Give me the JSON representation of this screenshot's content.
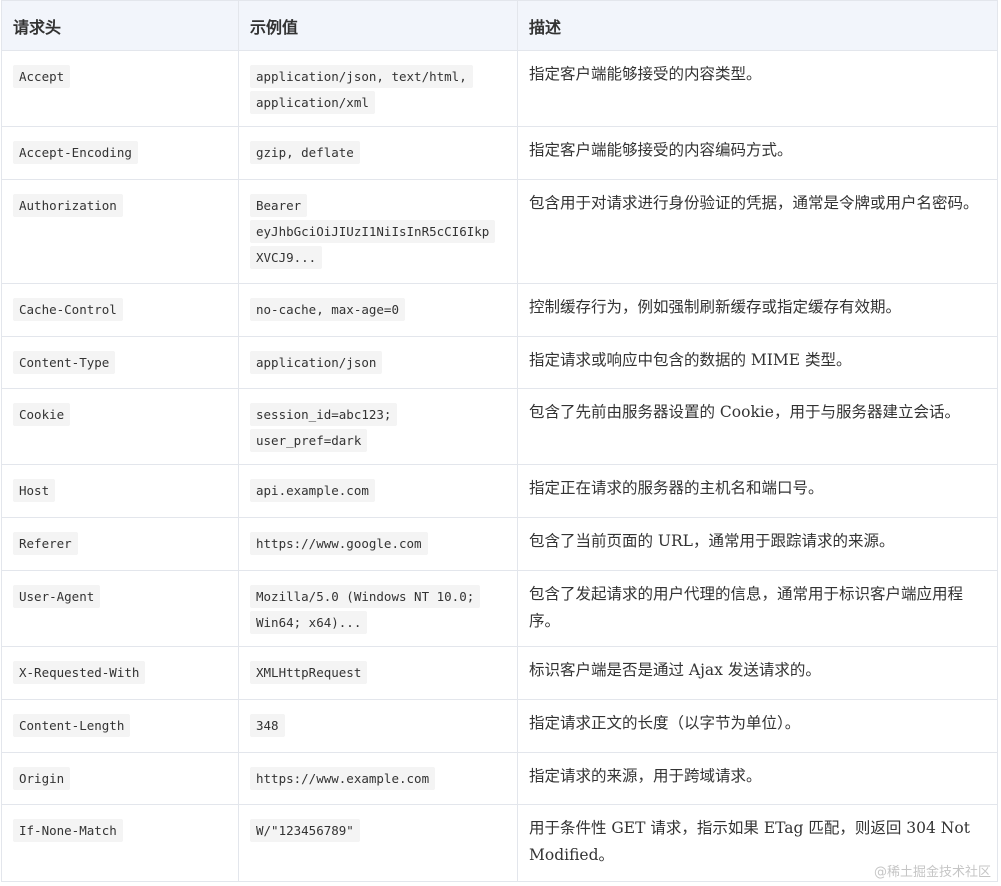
{
  "table": {
    "columns": [
      "请求头",
      "示例值",
      "描述"
    ],
    "rows": [
      {
        "header": "Accept",
        "example": [
          "application/json, text/html,",
          "application/xml"
        ],
        "desc": "指定客户端能够接受的内容类型。",
        "height": 76
      },
      {
        "header": "Accept-Encoding",
        "example": [
          "gzip, deflate"
        ],
        "desc": "指定客户端能够接受的内容编码方式。",
        "height": 53
      },
      {
        "header": "Authorization",
        "example": [
          "Bearer",
          "eyJhbGciOiJIUzI1NiIsInR5cCI6Ikp",
          "XVCJ9..."
        ],
        "desc": "包含用于对请求进行身份验证的凭据，通常是令牌或用户名密码。",
        "height": 104
      },
      {
        "header": "Cache-Control",
        "example": [
          "no-cache, max-age=0"
        ],
        "desc": "控制缓存行为，例如强制刷新缓存或指定缓存有效期。",
        "height": 53
      },
      {
        "header": "Content-Type",
        "example": [
          "application/json"
        ],
        "desc": "指定请求或响应中包含的数据的 MIME 类型。",
        "height": 52
      },
      {
        "header": "Cookie",
        "example": [
          "session_id=abc123;",
          "user_pref=dark"
        ],
        "desc": "包含了先前由服务器设置的 Cookie，用于与服务器建立会话。",
        "height": 76
      },
      {
        "header": "Host",
        "example": [
          "api.example.com"
        ],
        "desc": "指定正在请求的服务器的主机名和端口号。",
        "height": 53
      },
      {
        "header": "Referer",
        "example": [
          "https://www.google.com"
        ],
        "desc": "包含了当前页面的 URL，通常用于跟踪请求的来源。",
        "height": 53
      },
      {
        "header": "User-Agent",
        "example": [
          "Mozilla/5.0 (Windows NT 10.0;",
          "Win64; x64)..."
        ],
        "desc": "包含了发起请求的用户代理的信息，通常用于标识客户端应用程序。",
        "height": 76
      },
      {
        "header": "X-Requested-With",
        "example": [
          "XMLHttpRequest"
        ],
        "desc": "标识客户端是否是通过 Ajax 发送请求的。",
        "height": 53
      },
      {
        "header": "Content-Length",
        "example": [
          "348"
        ],
        "desc": "指定请求正文的长度（以字节为单位）。",
        "height": 53
      },
      {
        "header": "Origin",
        "example": [
          "https://www.example.com"
        ],
        "desc": "指定请求的来源，用于跨域请求。",
        "height": 52
      },
      {
        "header": "If-None-Match",
        "example": [
          "W/\"123456789\""
        ],
        "desc": "用于条件性 GET 请求，指示如果 ETag 匹配，则返回 304 Not Modified。",
        "height": 77
      }
    ]
  },
  "watermark": "@稀土掘金技术社区"
}
